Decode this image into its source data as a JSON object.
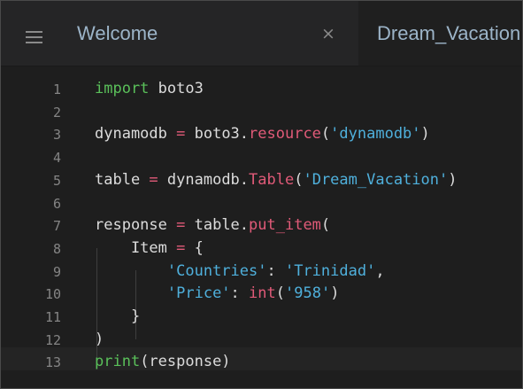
{
  "tabbar": {
    "tabs": [
      {
        "label": "Welcome"
      },
      {
        "label": "Dream_Vacation.py"
      }
    ],
    "close_symbol": "×",
    "menu_icon": "hamburger-menu-icon",
    "file_icon": "python-file-icon"
  },
  "editor": {
    "language": "python",
    "lines": [
      {
        "number": "1",
        "tokens": [
          [
            "kw",
            "import"
          ],
          [
            "txt",
            " boto3"
          ]
        ]
      },
      {
        "number": "2",
        "tokens": []
      },
      {
        "number": "3",
        "tokens": [
          [
            "txt",
            "dynamodb "
          ],
          [
            "op",
            "="
          ],
          [
            "txt",
            " boto3."
          ],
          [
            "fn",
            "resource"
          ],
          [
            "txt",
            "("
          ],
          [
            "str",
            "'dynamodb'"
          ],
          [
            "txt",
            ")"
          ]
        ]
      },
      {
        "number": "4",
        "tokens": []
      },
      {
        "number": "5",
        "tokens": [
          [
            "txt",
            "table "
          ],
          [
            "op",
            "="
          ],
          [
            "txt",
            " dynamodb."
          ],
          [
            "fn",
            "Table"
          ],
          [
            "txt",
            "("
          ],
          [
            "str",
            "'Dream_Vacation'"
          ],
          [
            "txt",
            ")"
          ]
        ]
      },
      {
        "number": "6",
        "tokens": []
      },
      {
        "number": "7",
        "tokens": [
          [
            "txt",
            "response "
          ],
          [
            "op",
            "="
          ],
          [
            "txt",
            " table."
          ],
          [
            "fn",
            "put_item"
          ],
          [
            "txt",
            "("
          ]
        ]
      },
      {
        "number": "8",
        "tokens": [
          [
            "txt",
            "    Item "
          ],
          [
            "op",
            "="
          ],
          [
            "txt",
            " {"
          ]
        ]
      },
      {
        "number": "9",
        "tokens": [
          [
            "txt",
            "        "
          ],
          [
            "str",
            "'Countries'"
          ],
          [
            "txt",
            ": "
          ],
          [
            "str",
            "'Trinidad'"
          ],
          [
            "txt",
            ","
          ]
        ]
      },
      {
        "number": "10",
        "tokens": [
          [
            "txt",
            "        "
          ],
          [
            "str",
            "'Price'"
          ],
          [
            "txt",
            ": "
          ],
          [
            "fn",
            "int"
          ],
          [
            "txt",
            "("
          ],
          [
            "str",
            "'958'"
          ],
          [
            "txt",
            ")"
          ]
        ]
      },
      {
        "number": "11",
        "tokens": [
          [
            "txt",
            "    }"
          ]
        ]
      },
      {
        "number": "12",
        "tokens": [
          [
            "txt",
            ")"
          ]
        ]
      },
      {
        "number": "13",
        "tokens": [
          [
            "kw",
            "print"
          ],
          [
            "txt",
            "(response)"
          ]
        ]
      }
    ]
  },
  "colors": {
    "keyword": "#5ac05a",
    "function": "#e05a78",
    "string": "#4fb0dc",
    "text": "#dcdcdc",
    "line_number": "#858585",
    "background": "#1e1e1e"
  }
}
